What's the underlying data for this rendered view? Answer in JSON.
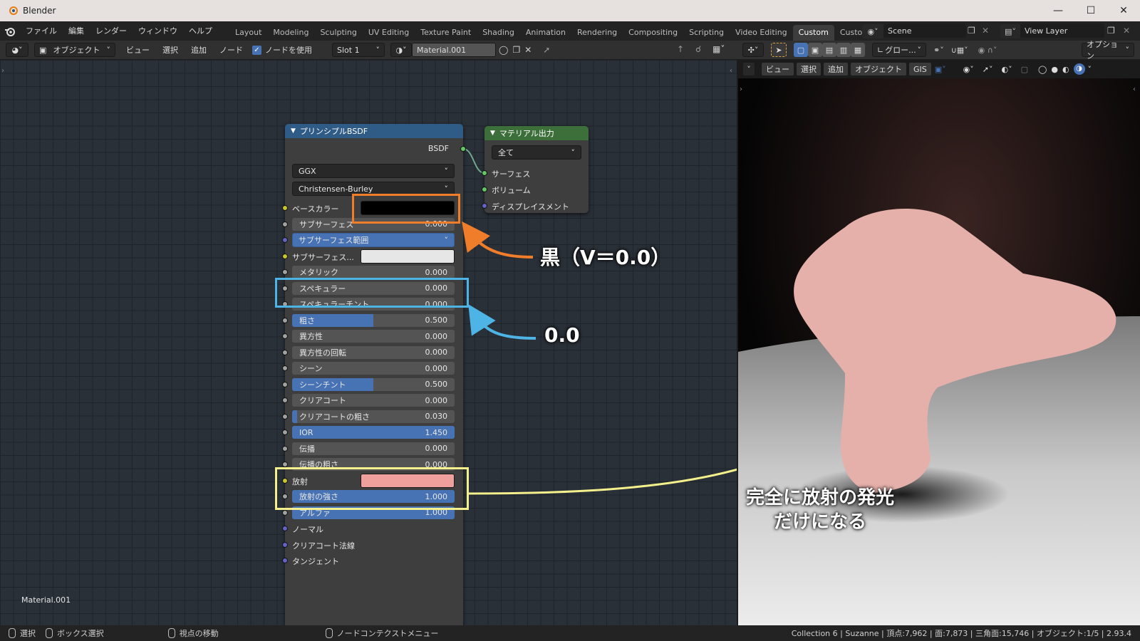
{
  "window": {
    "title": "Blender"
  },
  "menu": [
    "ファイル",
    "編集",
    "レンダー",
    "ウィンドウ",
    "ヘルプ"
  ],
  "workspaces": [
    "Layout",
    "Modeling",
    "Sculpting",
    "UV Editing",
    "Texture Paint",
    "Shading",
    "Animation",
    "Rendering",
    "Compositing",
    "Scripting",
    "Video Editing",
    "Custom",
    "Custon"
  ],
  "active_workspace": "Custom",
  "scene": "Scene",
  "view_layer": "View Layer",
  "node_header": {
    "mode": "オブジェクト",
    "view": "ビュー",
    "select": "選択",
    "add": "追加",
    "node": "ノード",
    "use_nodes": "ノードを使用",
    "slot": "Slot 1",
    "material": "Material.001"
  },
  "viewport_header": {
    "transform": "グロー...",
    "options": "オプション",
    "view": "ビュー",
    "select": "選択",
    "add": "追加",
    "object": "オブジェクト",
    "gis": "GIS"
  },
  "bsdf_node": {
    "title": "プリンシプルBSDF",
    "output": "BSDF",
    "distribution": "GGX",
    "subsurface_method": "Christensen-Burley",
    "props": [
      {
        "label": "ベースカラー",
        "type": "color",
        "color": "#000000"
      },
      {
        "label": "サブサーフェス",
        "value": "0.000",
        "fill": 0
      },
      {
        "label": "サブサーフェス範囲",
        "type": "dropdown"
      },
      {
        "label": "サブサーフェス...",
        "type": "color",
        "color": "#e6e6e6"
      },
      {
        "label": "メタリック",
        "value": "0.000",
        "fill": 0
      },
      {
        "label": "スペキュラー",
        "value": "0.000",
        "fill": 0
      },
      {
        "label": "スペキュラーチント",
        "value": "0.000",
        "fill": 0
      },
      {
        "label": "粗さ",
        "value": "0.500",
        "fill": 0.5
      },
      {
        "label": "異方性",
        "value": "0.000",
        "fill": 0
      },
      {
        "label": "異方性の回転",
        "value": "0.000",
        "fill": 0
      },
      {
        "label": "シーン",
        "value": "0.000",
        "fill": 0
      },
      {
        "label": "シーンチント",
        "value": "0.500",
        "fill": 0.5
      },
      {
        "label": "クリアコート",
        "value": "0.000",
        "fill": 0
      },
      {
        "label": "クリアコートの粗さ",
        "value": "0.030",
        "fill": 0.03
      },
      {
        "label": "IOR",
        "value": "1.450",
        "fill": 1
      },
      {
        "label": "伝播",
        "value": "0.000",
        "fill": 0
      },
      {
        "label": "伝播の粗さ",
        "value": "0.000",
        "fill": 0
      },
      {
        "label": "放射",
        "type": "color",
        "color": "#f0a09c"
      },
      {
        "label": "放射の強さ",
        "value": "1.000",
        "fill": 1
      },
      {
        "label": "アルファ",
        "value": "1.000",
        "fill": 1
      },
      {
        "label": "ノーマル",
        "type": "socket"
      },
      {
        "label": "クリアコート法線",
        "type": "socket"
      },
      {
        "label": "タンジェント",
        "type": "socket"
      }
    ]
  },
  "output_node": {
    "title": "マテリアル出力",
    "target": "全て",
    "inputs": [
      "サーフェス",
      "ボリューム",
      "ディスプレイスメント"
    ]
  },
  "annotations": {
    "black": "黒（V＝0.0）",
    "zero": "0.0",
    "emission_line1": "完全に放射の発光",
    "emission_line2": "だけになる"
  },
  "colors": {
    "orange": "#f07d2a",
    "blue": "#4eb4e6",
    "yellow": "#f4f08c",
    "bsdf_header": "#2f5b87",
    "output_header": "#3d6f3a",
    "suzanne": "#e6b0aa"
  },
  "material_label": "Material.001",
  "status": {
    "select": "選択",
    "box_select": "ボックス選択",
    "move_view": "視点の移動",
    "context_menu": "ノードコンテクストメニュー",
    "stats": "Collection 6 | Suzanne | 頂点:7,962 | 面:7,873 | 三角面:15,746 | オブジェクト:1/5 | 2.93.4"
  }
}
